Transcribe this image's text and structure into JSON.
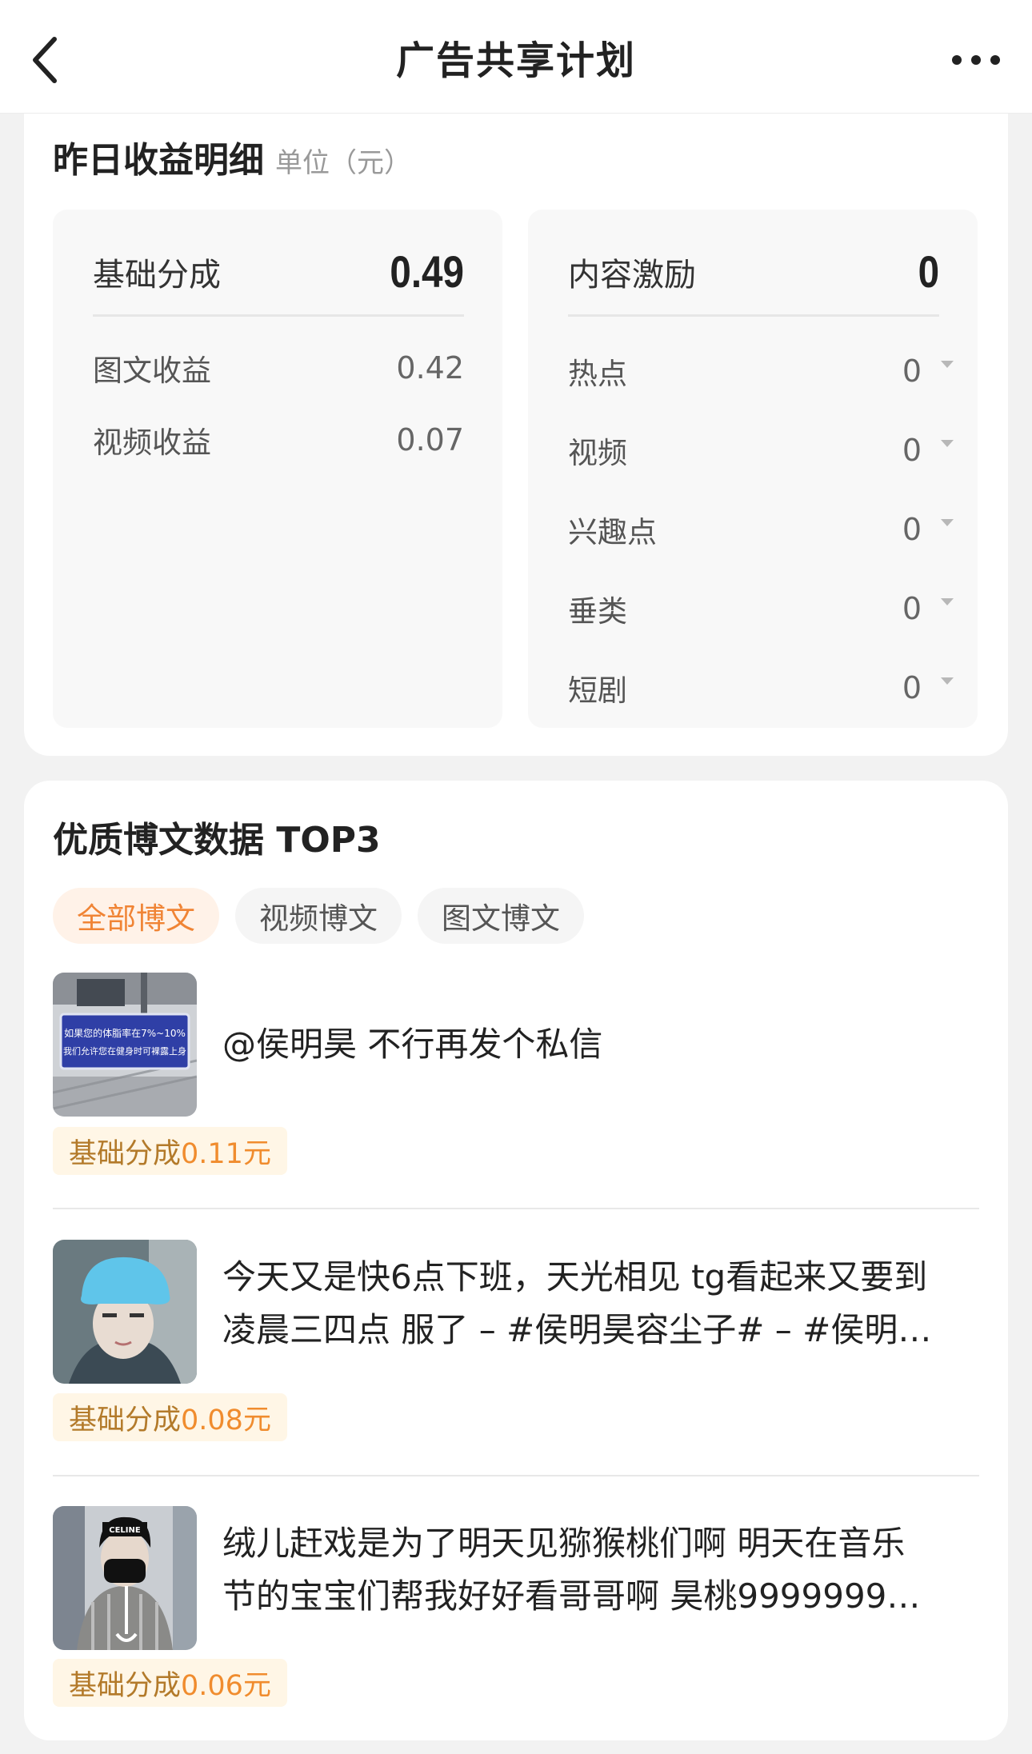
{
  "header": {
    "title": "广告共享计划"
  },
  "earnings": {
    "title": "昨日收益明细",
    "unit": "单位（元）",
    "basic": {
      "label": "基础分成",
      "value": "0.49",
      "rows": [
        {
          "label": "图文收益",
          "value": "0.42"
        },
        {
          "label": "视频收益",
          "value": "0.07"
        }
      ]
    },
    "incentive": {
      "label": "内容激励",
      "value": "0",
      "rows": [
        {
          "label": "热点",
          "value": "0"
        },
        {
          "label": "视频",
          "value": "0"
        },
        {
          "label": "兴趣点",
          "value": "0"
        },
        {
          "label": "垂类",
          "value": "0"
        },
        {
          "label": "短剧",
          "value": "0"
        }
      ]
    }
  },
  "top_posts": {
    "title": "优质博文数据 TOP3",
    "tabs": [
      {
        "label": "全部博文",
        "active": true
      },
      {
        "label": "视频博文",
        "active": false
      },
      {
        "label": "图文博文",
        "active": false
      }
    ],
    "posts": [
      {
        "text": "@侯明昊 不行再发个私信",
        "badge_label": "基础分成",
        "badge_value": "0.11元",
        "thumb_sign_line1": "如果您的体脂率在7%~10%",
        "thumb_sign_line2": "我们允许您在健身时可裸露上身"
      },
      {
        "text_line1": "今天又是快6点下班，天光相见 tg看起来又要到",
        "text_line2": "凌晨三四点 服了 – #侯明昊容尘子# – #侯明…",
        "badge_label": "基础分成",
        "badge_value": "0.08元"
      },
      {
        "text_line1": "绒儿赶戏是为了明天见猕猴桃们啊 明天在音乐",
        "text_line2": "节的宝宝们帮我好好看哥哥啊 昊桃9999999…",
        "badge_label": "基础分成",
        "badge_value": "0.06元",
        "thumb_logo": "CELINE"
      }
    ]
  }
}
